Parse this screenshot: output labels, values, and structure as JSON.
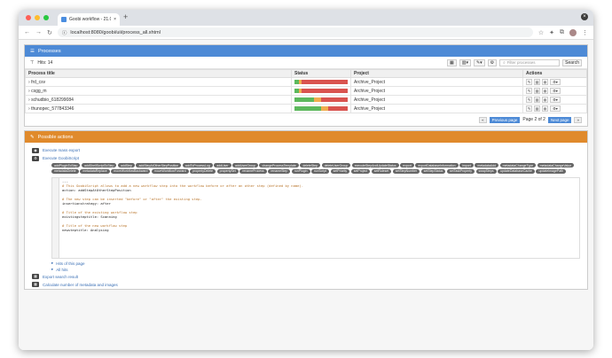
{
  "browser": {
    "tab_title": "Goobi workflow - 21.06-dev",
    "url": "localhost:8080/goobi/uii/process_all.xhtml"
  },
  "processes": {
    "title": "Processes",
    "hits": "Hits: 14",
    "filter_placeholder": "Filter processes",
    "search_label": "Search",
    "columns": [
      "Process title",
      "Status",
      "Project",
      "Actions"
    ],
    "rows": [
      {
        "title": "frd_csv",
        "project": "Archive_Project",
        "status": [
          0.09,
          0.05,
          0.86
        ]
      },
      {
        "title": "csgg_m",
        "project": "Archive_Project",
        "status": [
          0.09,
          0.05,
          0.86
        ]
      },
      {
        "title": "schudbio_618299084",
        "project": "Archive_Project",
        "status": [
          0.36,
          0.14,
          0.5
        ]
      },
      {
        "title": "thunopec_577843346",
        "project": "Archive_Project",
        "status": [
          0.5,
          0.14,
          0.36
        ]
      }
    ],
    "pager": {
      "prev": "Previous page",
      "page": "Page 2 of 2",
      "next": "Next page"
    }
  },
  "possible_actions": {
    "title": "Possible actions",
    "items": [
      "Execute mass export",
      "Execute GoobiScript"
    ],
    "goobiscript_chips": [
      "addPluginToStep",
      "addShellScriptToStep",
      "addStep",
      "addStepAtOtherStepPosition",
      "addToProcessLog",
      "addUser",
      "addUserGroup",
      "changeProcessTemplate",
      "deleteStep",
      "deleteUserGroup",
      "executeStepAndUpdateStatus",
      "export",
      "exportDatabaseInformation",
      "import",
      "metadataAdd",
      "metadataChangeType",
      "metadataChangeValue",
      "metadataDelete",
      "metadataReplace",
      "moveWorkflowBackward",
      "moveWorkflowForward",
      "propertyDelete",
      "propertySet",
      "renameProcess",
      "renameStep",
      "runPlugin",
      "runScript",
      "setPriority",
      "setProject",
      "setRuleset",
      "setStepNumber",
      "setStepStatus",
      "setTaskProperty",
      "swapSteps",
      "updateDatabaseCache",
      "updateImagePath"
    ],
    "code_lines": [
      {
        "text": "---",
        "kind": "kw"
      },
      {
        "text": "# This GoobiScript allows to add a new workflow step into the workflow before or after an other step (defined by name).",
        "kind": "cm"
      },
      {
        "text": "action: addStepAtOtherStepPosition",
        "kind": "kw"
      },
      {
        "text": "",
        "kind": "kw"
      },
      {
        "text": "# The new step can be inserted \"before\" or \"after\" the existing step.",
        "kind": "cm"
      },
      {
        "text": "insertionstrategy: after",
        "kind": "kw"
      },
      {
        "text": "",
        "kind": "kw"
      },
      {
        "text": "# Title of the existing workflow step",
        "kind": "cm"
      },
      {
        "text": "existingsteptitle: Scanning",
        "kind": "kw"
      },
      {
        "text": "",
        "kind": "kw"
      },
      {
        "text": "# Title of the new workflow step",
        "kind": "cm"
      },
      {
        "text": "newsteptitle: Analysing",
        "kind": "kw"
      }
    ],
    "sub_links": [
      "Hits of this page",
      "All hits"
    ],
    "more_items": [
      "Export search result",
      "Calculate number of metadata and images"
    ]
  },
  "colors": {
    "accent_blue": "#4d8ad6",
    "accent_orange": "#e08a2c",
    "status_green": "#5cb85c",
    "status_yellow": "#f0ad4e",
    "status_red": "#d9534f"
  }
}
